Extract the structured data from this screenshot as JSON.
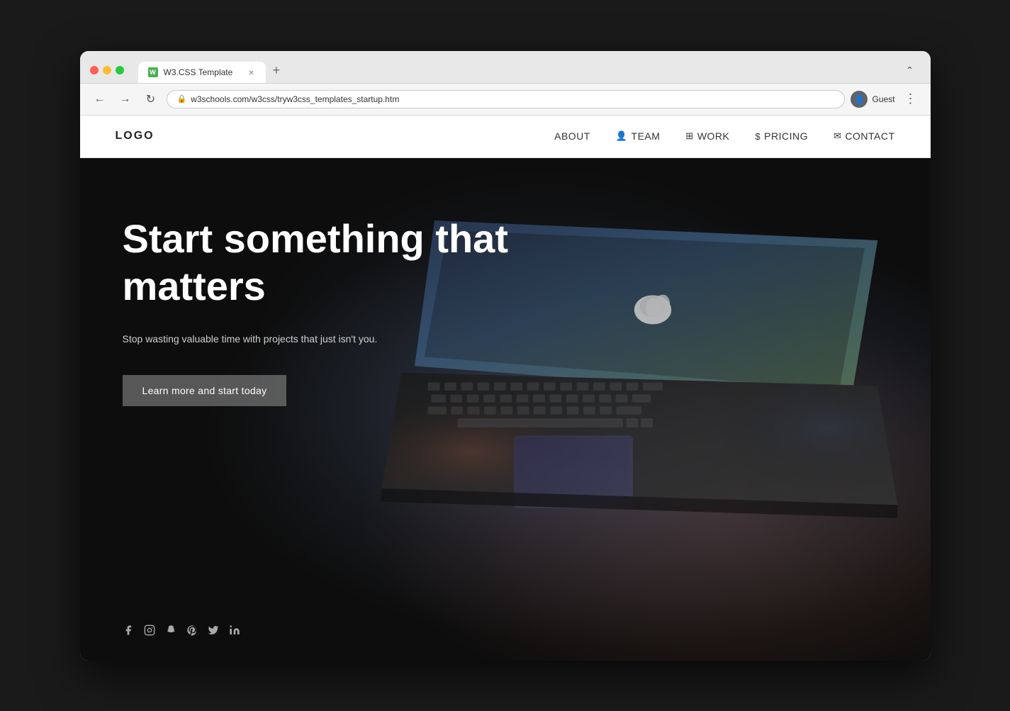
{
  "browser": {
    "tab": {
      "favicon_label": "W",
      "title": "W3.CSS Template",
      "close_label": "×",
      "new_tab_label": "+"
    },
    "nav": {
      "back_label": "←",
      "forward_label": "→",
      "refresh_label": "↻",
      "lock_icon": "🔒",
      "address": "w3schools.com/w3css/tryw3css_templates_startup.htm",
      "menu_label": "⋮",
      "user_label": "Guest",
      "user_icon": "👤"
    }
  },
  "site": {
    "logo": "LOGO",
    "nav_links": [
      {
        "label": "ABOUT",
        "icon": ""
      },
      {
        "label": "TEAM",
        "icon": "👤"
      },
      {
        "label": "WORK",
        "icon": "⊞"
      },
      {
        "label": "PRICING",
        "icon": "$"
      },
      {
        "label": "CONTACT",
        "icon": "✉"
      }
    ],
    "hero": {
      "title": "Start something that matters",
      "subtitle": "Stop wasting valuable time with projects that just isn't you.",
      "cta_label": "Learn more and start today"
    },
    "social_icons": [
      {
        "name": "facebook",
        "symbol": "f"
      },
      {
        "name": "instagram",
        "symbol": "◎"
      },
      {
        "name": "snapchat",
        "symbol": "⊙"
      },
      {
        "name": "pinterest",
        "symbol": "P"
      },
      {
        "name": "twitter",
        "symbol": "𝕏"
      },
      {
        "name": "linkedin",
        "symbol": "in"
      }
    ]
  }
}
